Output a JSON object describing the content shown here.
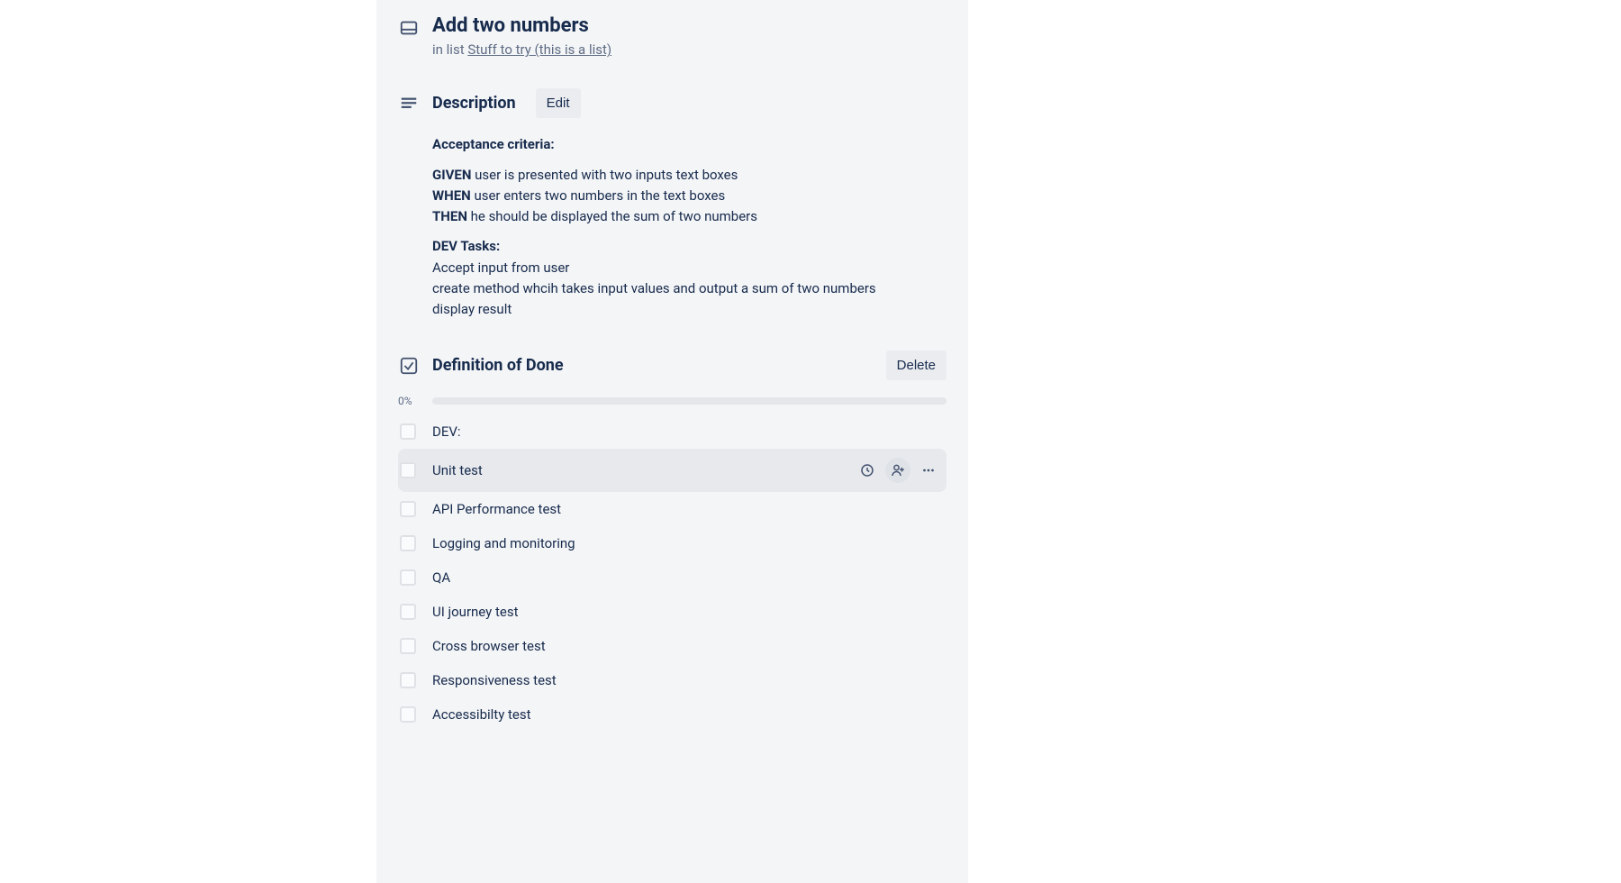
{
  "header": {
    "title": "Add two numbers",
    "in_list_prefix": "in list ",
    "list_name": "Stuff to try (this is a list)"
  },
  "description": {
    "heading": "Description",
    "edit_label": "Edit",
    "acceptance_label": "Acceptance criteria:",
    "given_kw": "GIVEN",
    "given_text": " user is presented with two inputs text boxes",
    "when_kw": "WHEN",
    "when_text": " user enters two numbers in the text boxes",
    "then_kw": "THEN",
    "then_text": " he should be displayed the sum of two numbers",
    "dev_label": "DEV Tasks:",
    "dev_line1": "Accept input from user",
    "dev_line2": "create method whcih takes input values and output a sum of two numbers",
    "dev_line3": "display result"
  },
  "checklist": {
    "heading": "Definition of Done",
    "delete_label": "Delete",
    "progress_pct": "0%",
    "items": [
      "DEV:",
      "Unit test",
      "API Performance test",
      "Logging and monitoring",
      "QA",
      "UI journey test",
      "Cross browser test",
      "Responsiveness test",
      "Accessibilty test"
    ],
    "hovered_index": 1
  },
  "icons": {
    "card": "card-icon",
    "description": "description-lines-icon",
    "checklist": "checkbox-icon",
    "clock": "clock-icon",
    "assign": "assign-person-icon",
    "more": "more-horizontal-icon"
  }
}
